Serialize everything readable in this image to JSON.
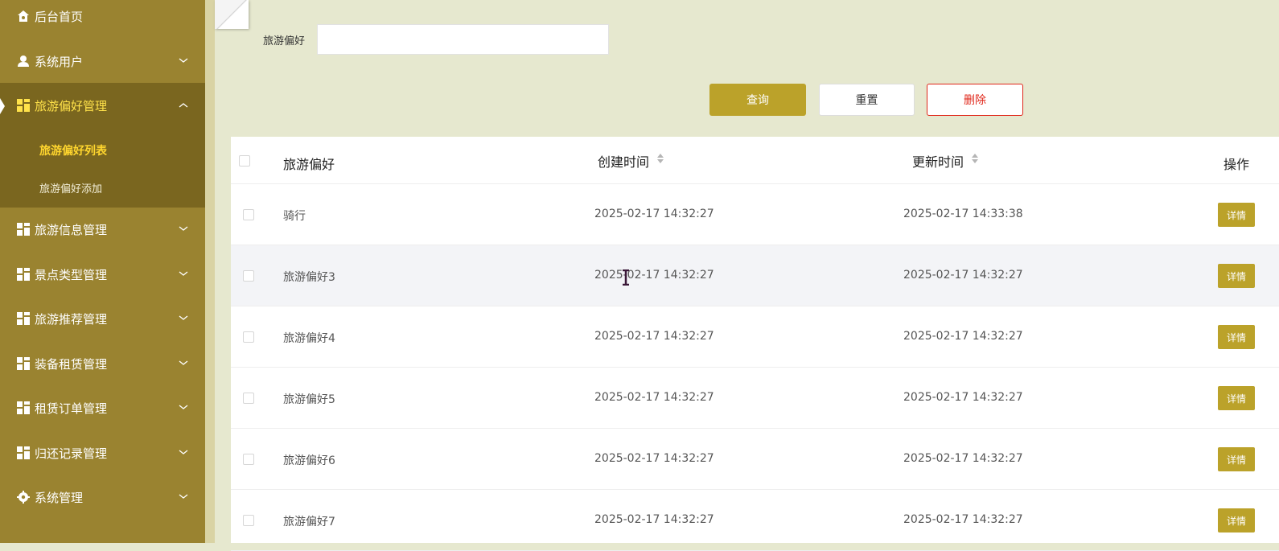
{
  "sidebar": {
    "items": [
      {
        "label": "后台首页",
        "icon": "home-icon",
        "caret": false
      },
      {
        "label": "系统用户",
        "icon": "user-icon",
        "caret": true
      },
      {
        "label": "旅游偏好管理",
        "icon": "grid-icon",
        "caret": true,
        "active": true
      },
      {
        "label": "旅游信息管理",
        "icon": "grid-icon",
        "caret": true
      },
      {
        "label": "景点类型管理",
        "icon": "grid-icon",
        "caret": true
      },
      {
        "label": "旅游推荐管理",
        "icon": "grid-icon",
        "caret": true
      },
      {
        "label": "装备租赁管理",
        "icon": "grid-icon",
        "caret": true
      },
      {
        "label": "租赁订单管理",
        "icon": "grid-icon",
        "caret": true
      },
      {
        "label": "归还记录管理",
        "icon": "grid-icon",
        "caret": true
      },
      {
        "label": "系统管理",
        "icon": "gear-icon",
        "caret": true
      }
    ],
    "submenu": [
      {
        "label": "旅游偏好列表",
        "current": true
      },
      {
        "label": "旅游偏好添加",
        "current": false
      }
    ]
  },
  "search": {
    "label": "旅游偏好",
    "value": ""
  },
  "buttons": {
    "query": "查询",
    "reset": "重置",
    "delete": "删除"
  },
  "table": {
    "headers": {
      "name": "旅游偏好",
      "created": "创建时间",
      "updated": "更新时间",
      "actions": "操作"
    },
    "detail_label": "详情",
    "rows": [
      {
        "name": "骑行",
        "created": "2025-02-17 14:32:27",
        "updated": "2025-02-17 14:33:38"
      },
      {
        "name": "旅游偏好3",
        "created": "2025-02-17 14:32:27",
        "updated": "2025-02-17 14:32:27"
      },
      {
        "name": "旅游偏好4",
        "created": "2025-02-17 14:32:27",
        "updated": "2025-02-17 14:32:27"
      },
      {
        "name": "旅游偏好5",
        "created": "2025-02-17 14:32:27",
        "updated": "2025-02-17 14:32:27"
      },
      {
        "name": "旅游偏好6",
        "created": "2025-02-17 14:32:27",
        "updated": "2025-02-17 14:32:27"
      },
      {
        "name": "旅游偏好7",
        "created": "2025-02-17 14:32:27",
        "updated": "2025-02-17 14:32:27"
      }
    ]
  },
  "colors": {
    "sidebar": "#9a8330",
    "accent": "#bba22a",
    "active_text": "#ffe24a",
    "danger": "#e0271a"
  }
}
